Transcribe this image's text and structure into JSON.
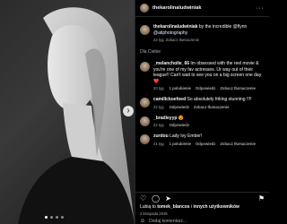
{
  "post": {
    "author": "thekarolinaludwiniak",
    "caption_author": "thekarolinaludwiniak",
    "caption_text": "by the incredible",
    "caption_mentions": "@flynn",
    "caption_mention2": "@atiphotography",
    "caption_meta": "22 tyg.   Zobacz tłumaczenie",
    "section_label": "Dla Ciebie",
    "comments": [
      {
        "user": "_melancholie_66",
        "text": "Im obsessed with the reel movie & you're one of my fav actresses. Ur way out of their league!! Can't wait to see you on a big screen one day ❤️",
        "time": "20 tyg.",
        "likes": "1 polubienie",
        "reply": "Odpowiedz",
        "translate": "Zobacz tłumaczenie"
      },
      {
        "user": "camillckoefoed",
        "text": "So absolutely friking stunning !!!!",
        "time": "22 tyg.",
        "reply": "Odpowiedz",
        "translate": "Zobacz tłumaczenie"
      },
      {
        "user": "_bradleyyp",
        "text": "😍",
        "time": "22 tyg.",
        "reply": "Odpowiedz",
        "translate": ""
      },
      {
        "user": "zurdou",
        "text": "Lady Ivy Ember!",
        "time": "21 tyg.",
        "likes": "1 polubienie",
        "reply": "Odpowiedz",
        "translate": "Zobacz tłumaczenie"
      }
    ],
    "likes_prefix": "Lubią to",
    "likes_user": "tomek_blancos",
    "likes_suffix": "i",
    "likes_others": "innych użytkowników",
    "date": "2 listopada 2025",
    "comment_placeholder": "Dodaj komentarz..."
  }
}
